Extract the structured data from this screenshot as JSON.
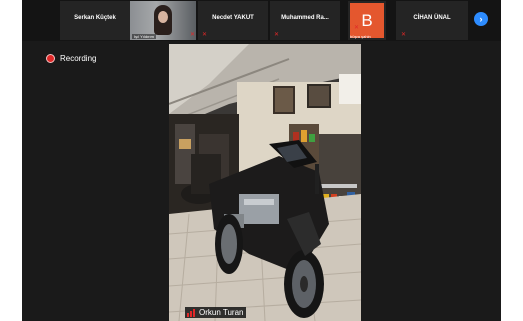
{
  "gallery": {
    "participants": [
      {
        "name": "Serkan Küçtek",
        "muted": false
      },
      {
        "name": "",
        "caption": "Işıl Yıldırım",
        "muted": true
      },
      {
        "name": "Necdet YAKUT",
        "muted": true
      },
      {
        "name": "Muhammed  Ra...",
        "muted": true
      },
      {
        "name": "",
        "initial": "B",
        "caption": "büşra şahin",
        "muted": true
      },
      {
        "name": "CİHAN ÜNAL",
        "muted": true
      }
    ],
    "next_icon": "chevron-right-icon"
  },
  "recording": {
    "label": "Recording"
  },
  "stage": {
    "speaker_name": "Orkun Turan"
  },
  "colors": {
    "accent": "#2d8cff",
    "record_red": "#e02828",
    "avatar_orange": "#e4572e",
    "background": "#1a1a1a"
  }
}
